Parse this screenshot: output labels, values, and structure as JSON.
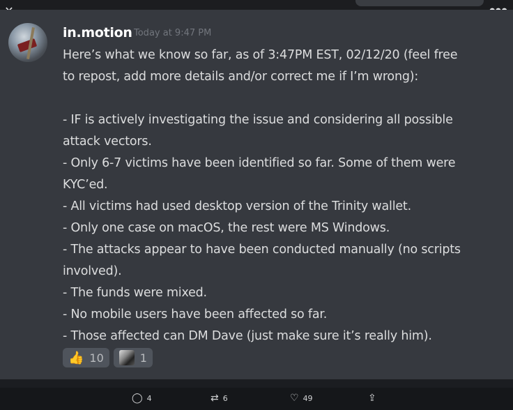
{
  "window": {
    "close_icon": "close-icon",
    "more_icon": "more-dots-icon"
  },
  "message": {
    "username": "in.motion",
    "timestamp": "Today at 9:47 PM",
    "lines": [
      "Here’s what we know so far, as of 3:47PM EST, 02/12/20 (feel free",
      "to repost, add more details and/or correct me if I’m wrong):",
      "",
      "- IF is actively investigating the issue and considering all possible",
      "attack vectors.",
      "- Only 6-7 victims have been identified so far. Some of them were",
      "KYC’ed.",
      "- All victims had used desktop version of the Trinity wallet.",
      "- Only one case on macOS, the rest were MS Windows.",
      "- The attacks appear to have been conducted manually (no scripts",
      "involved).",
      "- The funds were mixed.",
      "- No mobile users have been affected so far.",
      "- Those affected can DM Dave (just make sure it’s really him)."
    ],
    "reactions": [
      {
        "emoji": "👍",
        "icon": "thumbs-up-emoji",
        "count": "10"
      },
      {
        "emoji": "",
        "icon": "custom-avatar-emoji",
        "count": "1"
      }
    ]
  },
  "tweet_actions": {
    "reply": {
      "icon": "reply-icon",
      "glyph": "◯",
      "count": "4"
    },
    "retweet": {
      "icon": "retweet-icon",
      "glyph": "⇄",
      "count": "6"
    },
    "like": {
      "icon": "heart-icon",
      "glyph": "♡",
      "count": "49"
    },
    "share": {
      "icon": "share-icon",
      "glyph": "⇪"
    }
  }
}
